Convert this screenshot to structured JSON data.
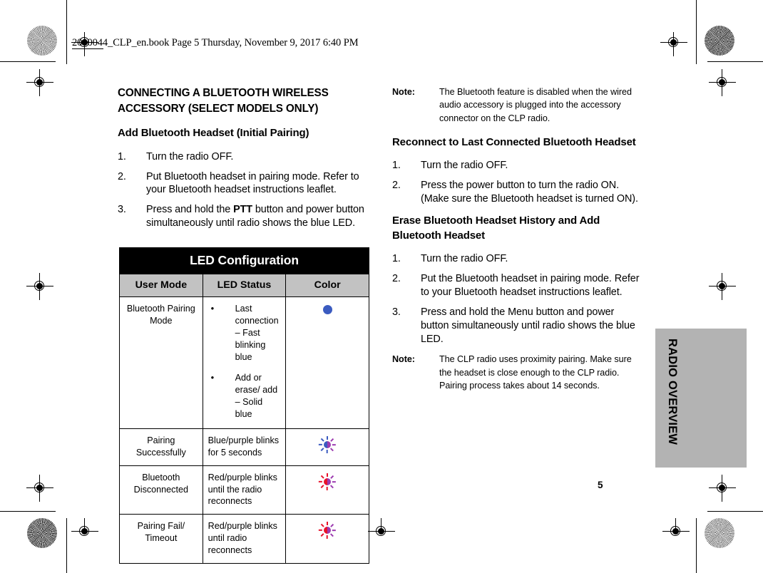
{
  "document": {
    "file_stamp": "2000044_CLP_en.book  Page 5  Thursday, November 9, 2017  6:40 PM",
    "page_number": "5",
    "side_tab_label": "RADIO OVERVIEW"
  },
  "left_column": {
    "section_heading": "CONNECTING A BLUETOOTH WIRELESS ACCESSORY (SELECT MODELS ONLY)",
    "subsection_heading": "Add Bluetooth Headset (Initial Pairing)",
    "steps": [
      {
        "num": "1.",
        "text": "Turn the radio OFF."
      },
      {
        "num": "2.",
        "text": "Put Bluetooth headset in pairing mode. Refer to your Bluetooth headset instructions leaflet."
      },
      {
        "num": "3.",
        "text_before": "Press and hold the ",
        "bold": "PTT",
        "text_after": " button and power button simultaneously until radio shows the blue LED."
      }
    ]
  },
  "right_column": {
    "note_1": {
      "label": "Note:",
      "text": "The Bluetooth feature is disabled when the wired audio accessory is plugged into the accessory connector on the CLP radio."
    },
    "heading_2": "Reconnect to Last Connected Bluetooth Headset",
    "steps_2": [
      {
        "num": "1.",
        "text": "Turn the radio OFF."
      },
      {
        "num": "2.",
        "text": "Press the power button to turn the radio ON. (Make sure the Bluetooth headset is turned ON)."
      }
    ],
    "heading_3": "Erase Bluetooth Headset History and Add Bluetooth Headset",
    "steps_3": [
      {
        "num": "1.",
        "text": "Turn the radio OFF."
      },
      {
        "num": "2.",
        "text": "Put the Bluetooth headset in pairing mode. Refer to your Bluetooth headset instructions leaflet."
      },
      {
        "num": "3.",
        "text": "Press and hold the Menu button and power button simultaneously until radio shows the blue LED."
      }
    ],
    "note_2": {
      "label": "Note:",
      "text": "The CLP radio uses proximity pairing. Make sure the headset is close enough to the CLP radio. Pairing process takes about 14 seconds."
    }
  },
  "led_table": {
    "title": "LED Configuration",
    "headers": [
      "User Mode",
      "LED Status",
      "Color"
    ],
    "rows": [
      {
        "mode": "Bluetooth Pairing Mode",
        "status_bullets": [
          "Last connection – Fast blinking blue",
          "Add or erase/ add – Solid blue"
        ],
        "color_icon": "solid-blue-dot",
        "color_hex": "#3b5bc0"
      },
      {
        "mode": "Pairing Successfully",
        "status": "Blue/purple blinks for 5 seconds",
        "color_icon": "blue-purple-blinking-led",
        "color_hex_a": "#3b5bc0",
        "color_hex_b": "#9c3bb0"
      },
      {
        "mode": "Bluetooth Disconnected",
        "status": "Red/purple blinks until the radio reconnects",
        "color_icon": "red-purple-blinking-led",
        "color_hex_a": "#e8122a",
        "color_hex_b": "#9c3bb0"
      },
      {
        "mode": "Pairing Fail/ Timeout",
        "status": "Red/purple blinks until radio reconnects",
        "color_icon": "red-purple-blinking-led",
        "color_hex_a": "#e8122a",
        "color_hex_b": "#9c3bb0"
      }
    ],
    "bullet_glyph": "•"
  }
}
